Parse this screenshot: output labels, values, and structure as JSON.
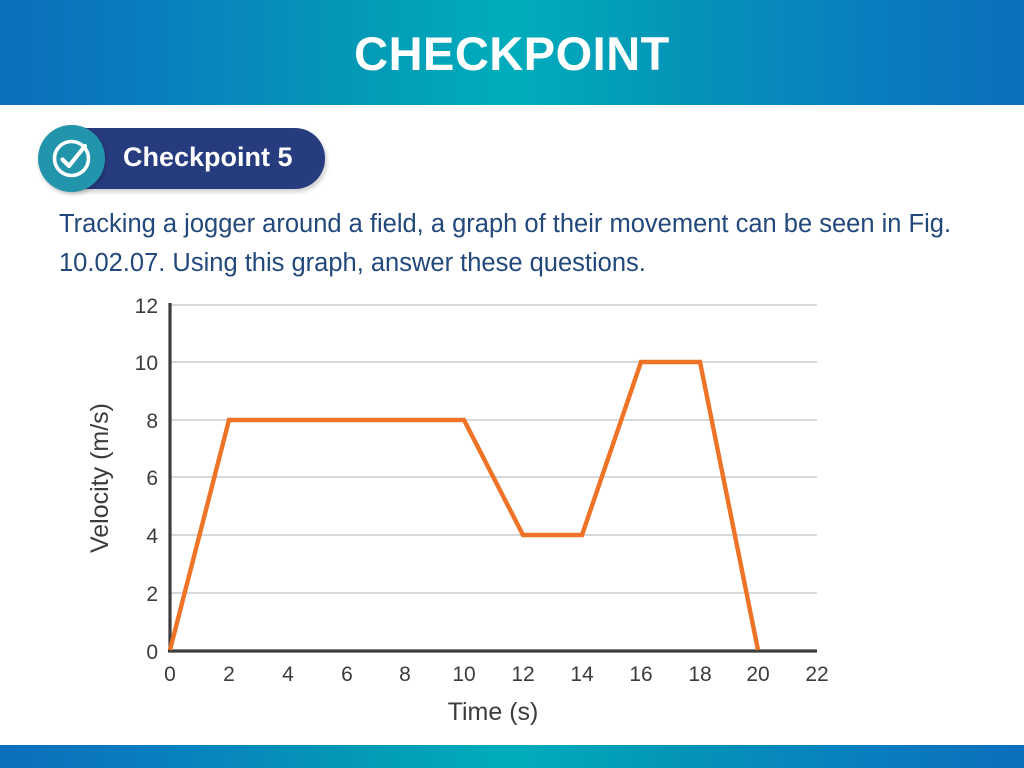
{
  "banner": {
    "title": "CHECKPOINT",
    "gradient_edge": "#0a6fbb",
    "gradient_center": "#00adbc"
  },
  "badge": {
    "label": "Checkpoint 5",
    "icon": "check-circle-icon",
    "pill_color": "#273b7f",
    "circle_color": "#2295ad"
  },
  "prompt": {
    "text": "Tracking a jogger around a field, a graph of their movement can be seen in Fig. 10.02.07. Using this graph, answer these questions.",
    "color": "#22487c"
  },
  "chart_data": {
    "type": "line",
    "title": "",
    "xlabel": "Time (s)",
    "ylabel": "Velocity (m/s)",
    "xlim": [
      0,
      22
    ],
    "ylim": [
      0,
      12
    ],
    "xticks": [
      0,
      2,
      4,
      6,
      8,
      10,
      12,
      14,
      16,
      18,
      20,
      22
    ],
    "yticks": [
      0,
      2,
      4,
      6,
      8,
      10,
      12
    ],
    "grid": "horizontal",
    "legend": "none",
    "line_color": "#ee7326",
    "line_width": 4,
    "series": [
      {
        "name": "velocity",
        "x": [
          0,
          2,
          10,
          12,
          14,
          16,
          18,
          20
        ],
        "y": [
          0,
          8,
          8,
          4,
          4,
          10,
          10,
          0
        ]
      }
    ]
  }
}
